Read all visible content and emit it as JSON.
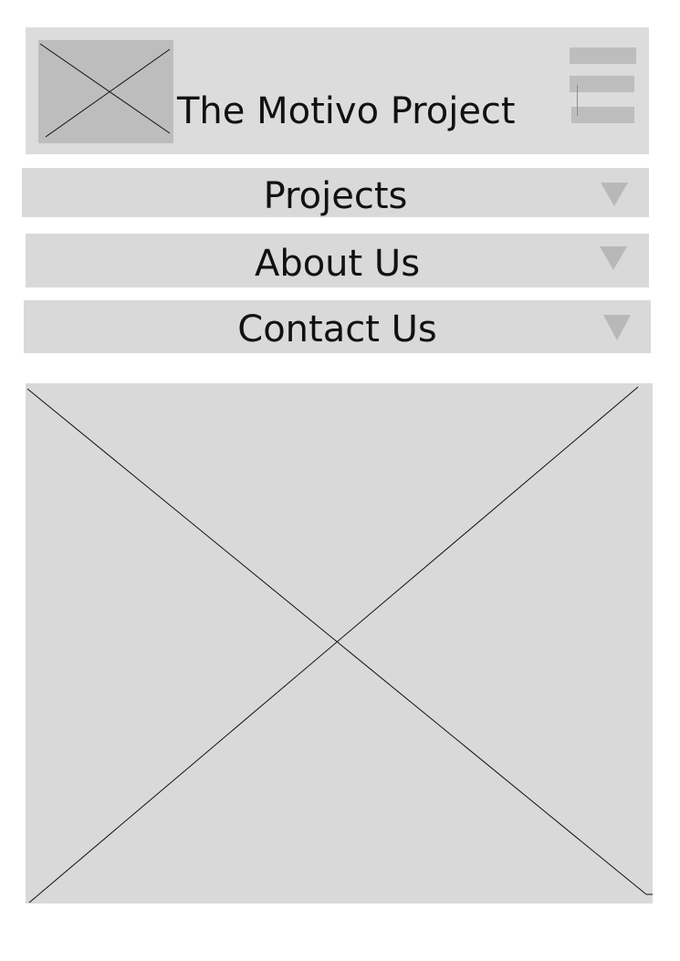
{
  "header": {
    "title": "The Motivo Project",
    "logo_icon": "image-placeholder-icon",
    "menu_icon": "hamburger-menu-icon"
  },
  "nav": {
    "items": [
      {
        "label": "Projects",
        "icon": "chevron-down-icon"
      },
      {
        "label": "About Us",
        "icon": "chevron-down-icon"
      },
      {
        "label": "Contact Us",
        "icon": "chevron-down-icon"
      }
    ]
  },
  "hero": {
    "icon": "image-placeholder-icon"
  },
  "colors": {
    "panel": "#dcdcdc",
    "placeholder": "#bdbdbd",
    "text": "#111111"
  }
}
